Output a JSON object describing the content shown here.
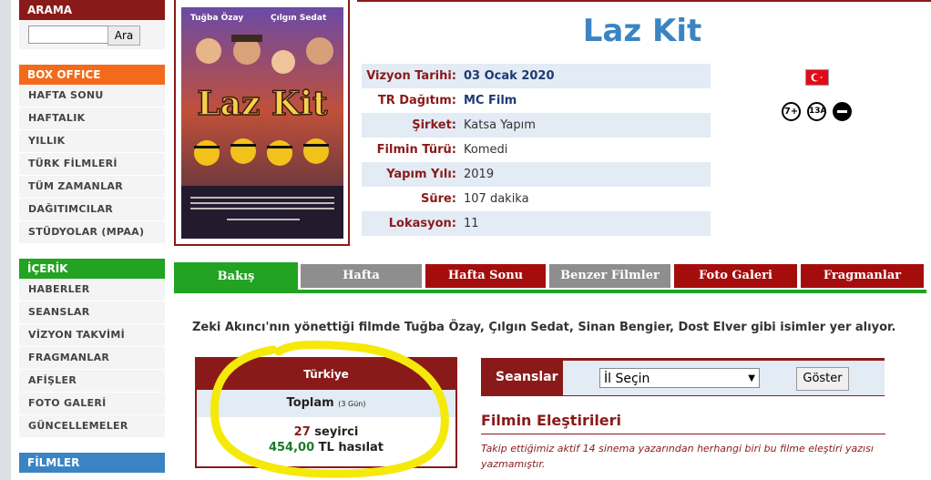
{
  "sidebar": {
    "search": {
      "title": "ARAMA",
      "placeholder": "",
      "button": "Ara"
    },
    "box_office": {
      "title": "BOX OFFICE",
      "items": [
        "HAFTA SONU",
        "HAFTALIK",
        "YILLIK",
        "TÜRK FİLMLERİ",
        "TÜM ZAMANLAR",
        "DAĞITIMCILAR",
        "STÜDYOLAR (MPAA)"
      ]
    },
    "icerik": {
      "title": "İÇERİK",
      "items": [
        "HABERLER",
        "SEANSLAR",
        "VİZYON TAKVİMİ",
        "FRAGMANLAR",
        "AFİŞLER",
        "FOTO GALERİ",
        "GÜNCELLEMELER"
      ]
    },
    "filmler": {
      "title": "FİLMLER"
    }
  },
  "movie": {
    "title": "Laz Kit",
    "poster": {
      "actors": [
        "Tuğba Özay",
        "Çılgın Sedat"
      ],
      "title": "Laz Kit"
    },
    "info": [
      {
        "label": "Vizyon Tarihi:",
        "value": "03 Ocak 2020",
        "link": true
      },
      {
        "label": "TR Dağıtım:",
        "value": "MC Film",
        "link": true
      },
      {
        "label": "Şirket:",
        "value": "Katsa Yapım",
        "link": false
      },
      {
        "label": "Filmin Türü:",
        "value": "Komedi",
        "link": false
      },
      {
        "label": "Yapım Yılı:",
        "value": "2019",
        "link": false
      },
      {
        "label": "Süre:",
        "value": "107 dakika",
        "link": false
      },
      {
        "label": "Lokasyon:",
        "value": "11",
        "link": false
      }
    ],
    "ratings": [
      "7+",
      "13A"
    ]
  },
  "tabs": [
    "Bakış",
    "Hafta",
    "Hafta Sonu",
    "Benzer Filmler",
    "Foto Galeri",
    "Fragmanlar"
  ],
  "description": "Zeki Akıncı'nın yönettiği filmde Tuğba Özay, Çılgın Sedat, Sinan Bengier, Dost Elver gibi isimler yer alıyor.",
  "stats": {
    "region": "Türkiye",
    "total_label": "Toplam",
    "total_days": "(3 Gün)",
    "viewers_num": "27",
    "viewers_word": "seyirci",
    "revenue_num": "454,00",
    "revenue_word": "TL hasılat"
  },
  "seans": {
    "label": "Seanslar",
    "select_value": "İl Seçin",
    "button": "Göster"
  },
  "critics": {
    "title": "Filmin Eleştirileri",
    "text": "Takip ettiğimiz aktif 14 sinema yazarından herhangi biri bu filme eleştiri yazısı yazmamıştır."
  },
  "colors": {
    "accent": "#8a1a1a",
    "title_blue": "#3b84c4",
    "box_office": "#f26a1b",
    "icerik": "#22a322",
    "filmler": "#3b84c4"
  }
}
